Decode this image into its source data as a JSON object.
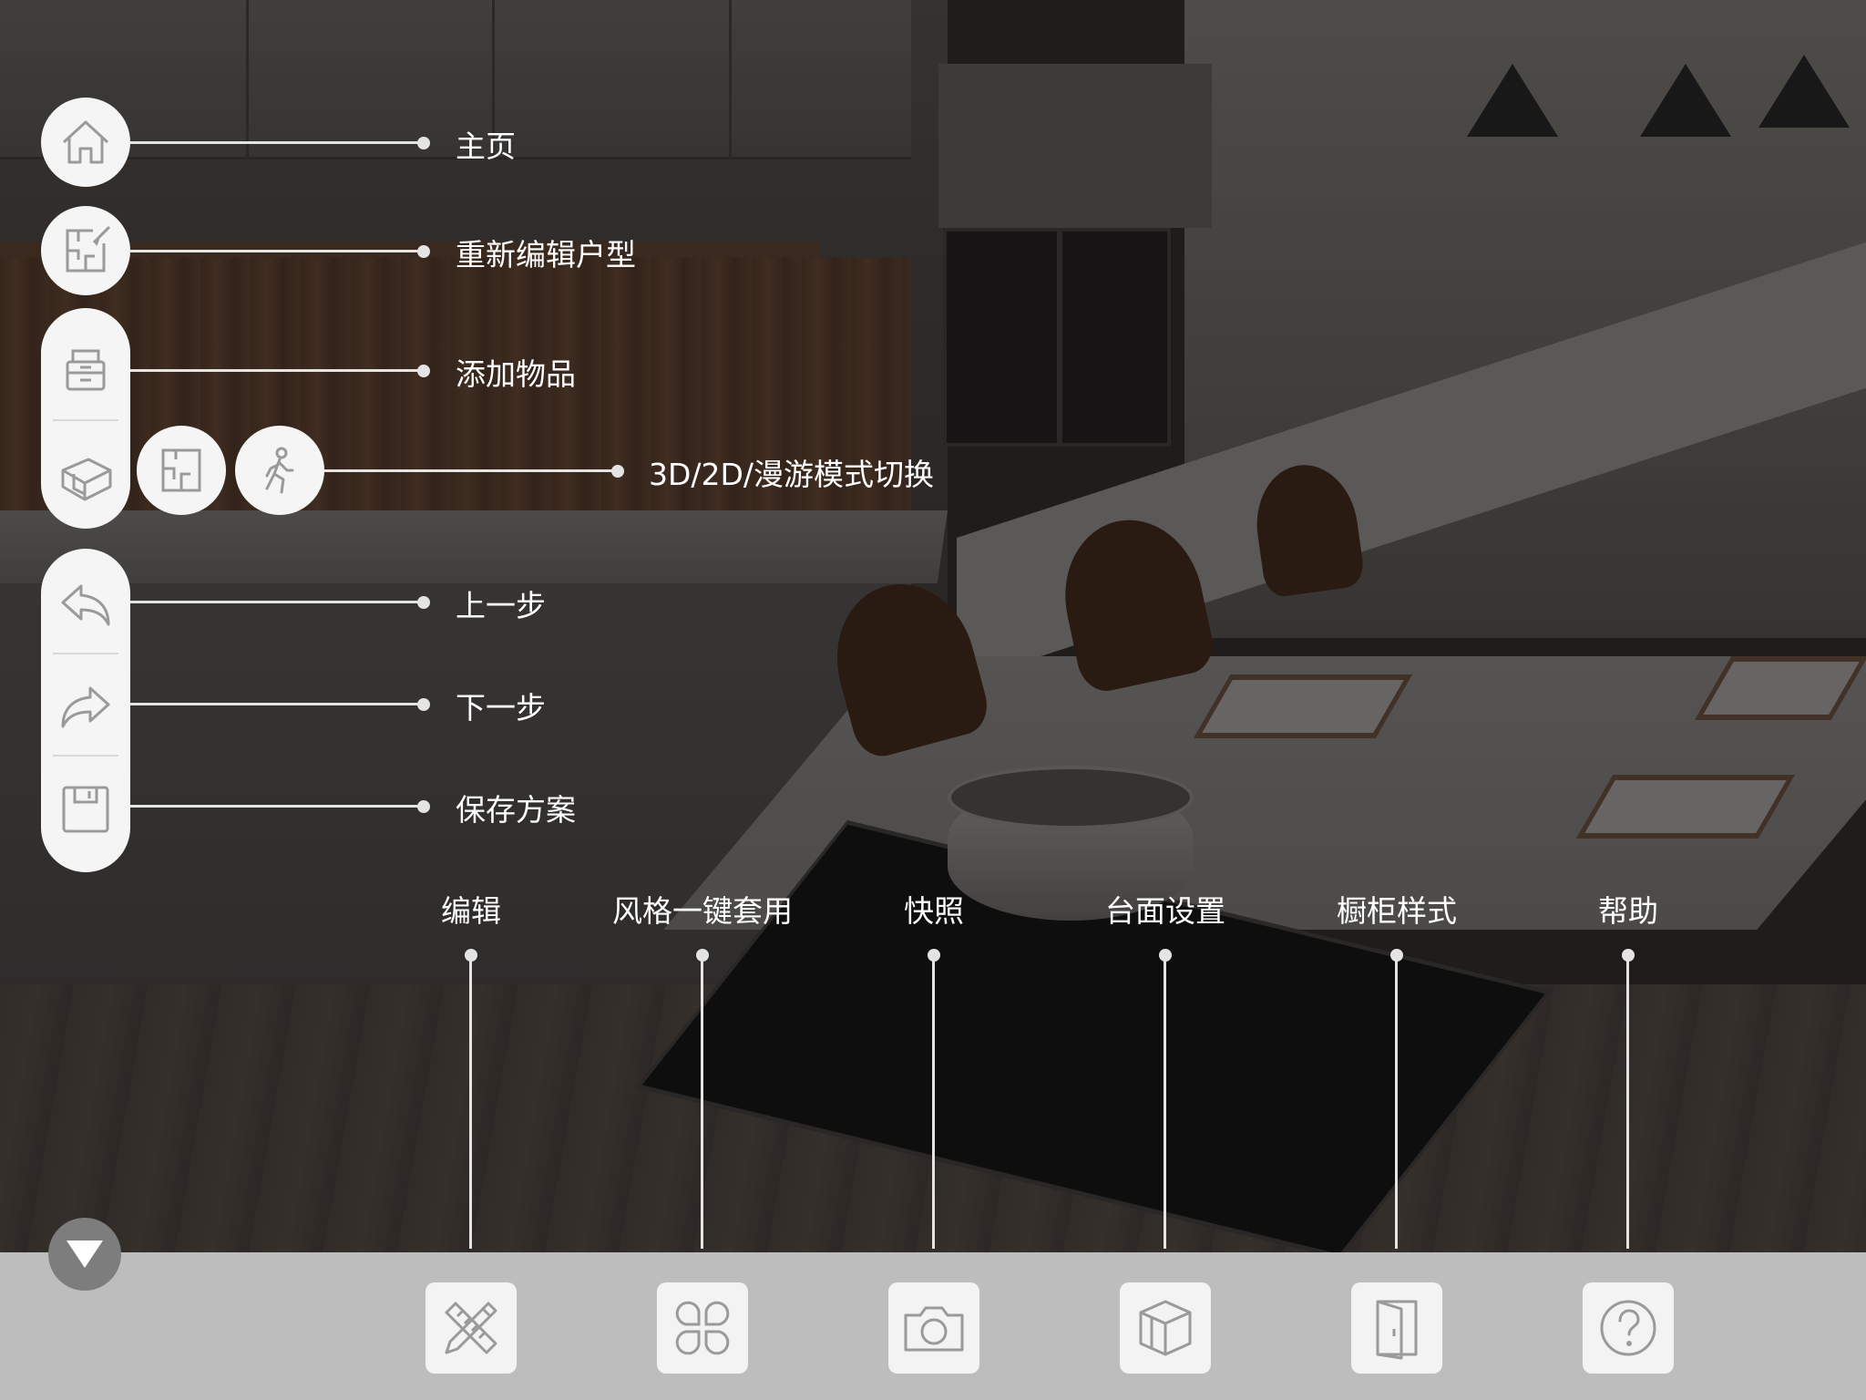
{
  "side_menu": {
    "home": {
      "label": "主页",
      "icon": "home-icon"
    },
    "re_edit_floorplan": {
      "label": "重新编辑户型",
      "icon": "floorplan-edit-icon"
    },
    "add_items": {
      "label": "添加物品",
      "icon": "furniture-icon"
    },
    "view_mode": {
      "label": "3D/2D/漫游模式切换",
      "icons": [
        "3d-box-icon",
        "2d-floorplan-icon",
        "walk-icon"
      ]
    },
    "undo": {
      "label": "上一步",
      "icon": "undo-icon"
    },
    "redo": {
      "label": "下一步",
      "icon": "redo-icon"
    },
    "save": {
      "label": "保存方案",
      "icon": "save-icon"
    }
  },
  "bottom_tools": [
    {
      "label": "编辑",
      "icon": "ruler-pencil-icon"
    },
    {
      "label": "风格一键套用",
      "icon": "style-grid-icon"
    },
    {
      "label": "快照",
      "icon": "camera-icon"
    },
    {
      "label": "台面设置",
      "icon": "cube-icon"
    },
    {
      "label": "橱柜样式",
      "icon": "door-icon"
    },
    {
      "label": "帮助",
      "icon": "help-icon"
    }
  ],
  "collapse_icon": "chevron-down-icon",
  "colors": {
    "overlay_line": "#e4e4e4",
    "button_bg": "#f5f5f5",
    "icon_stroke": "#9a9a9a",
    "bottom_bar": "#bdbdbd"
  }
}
